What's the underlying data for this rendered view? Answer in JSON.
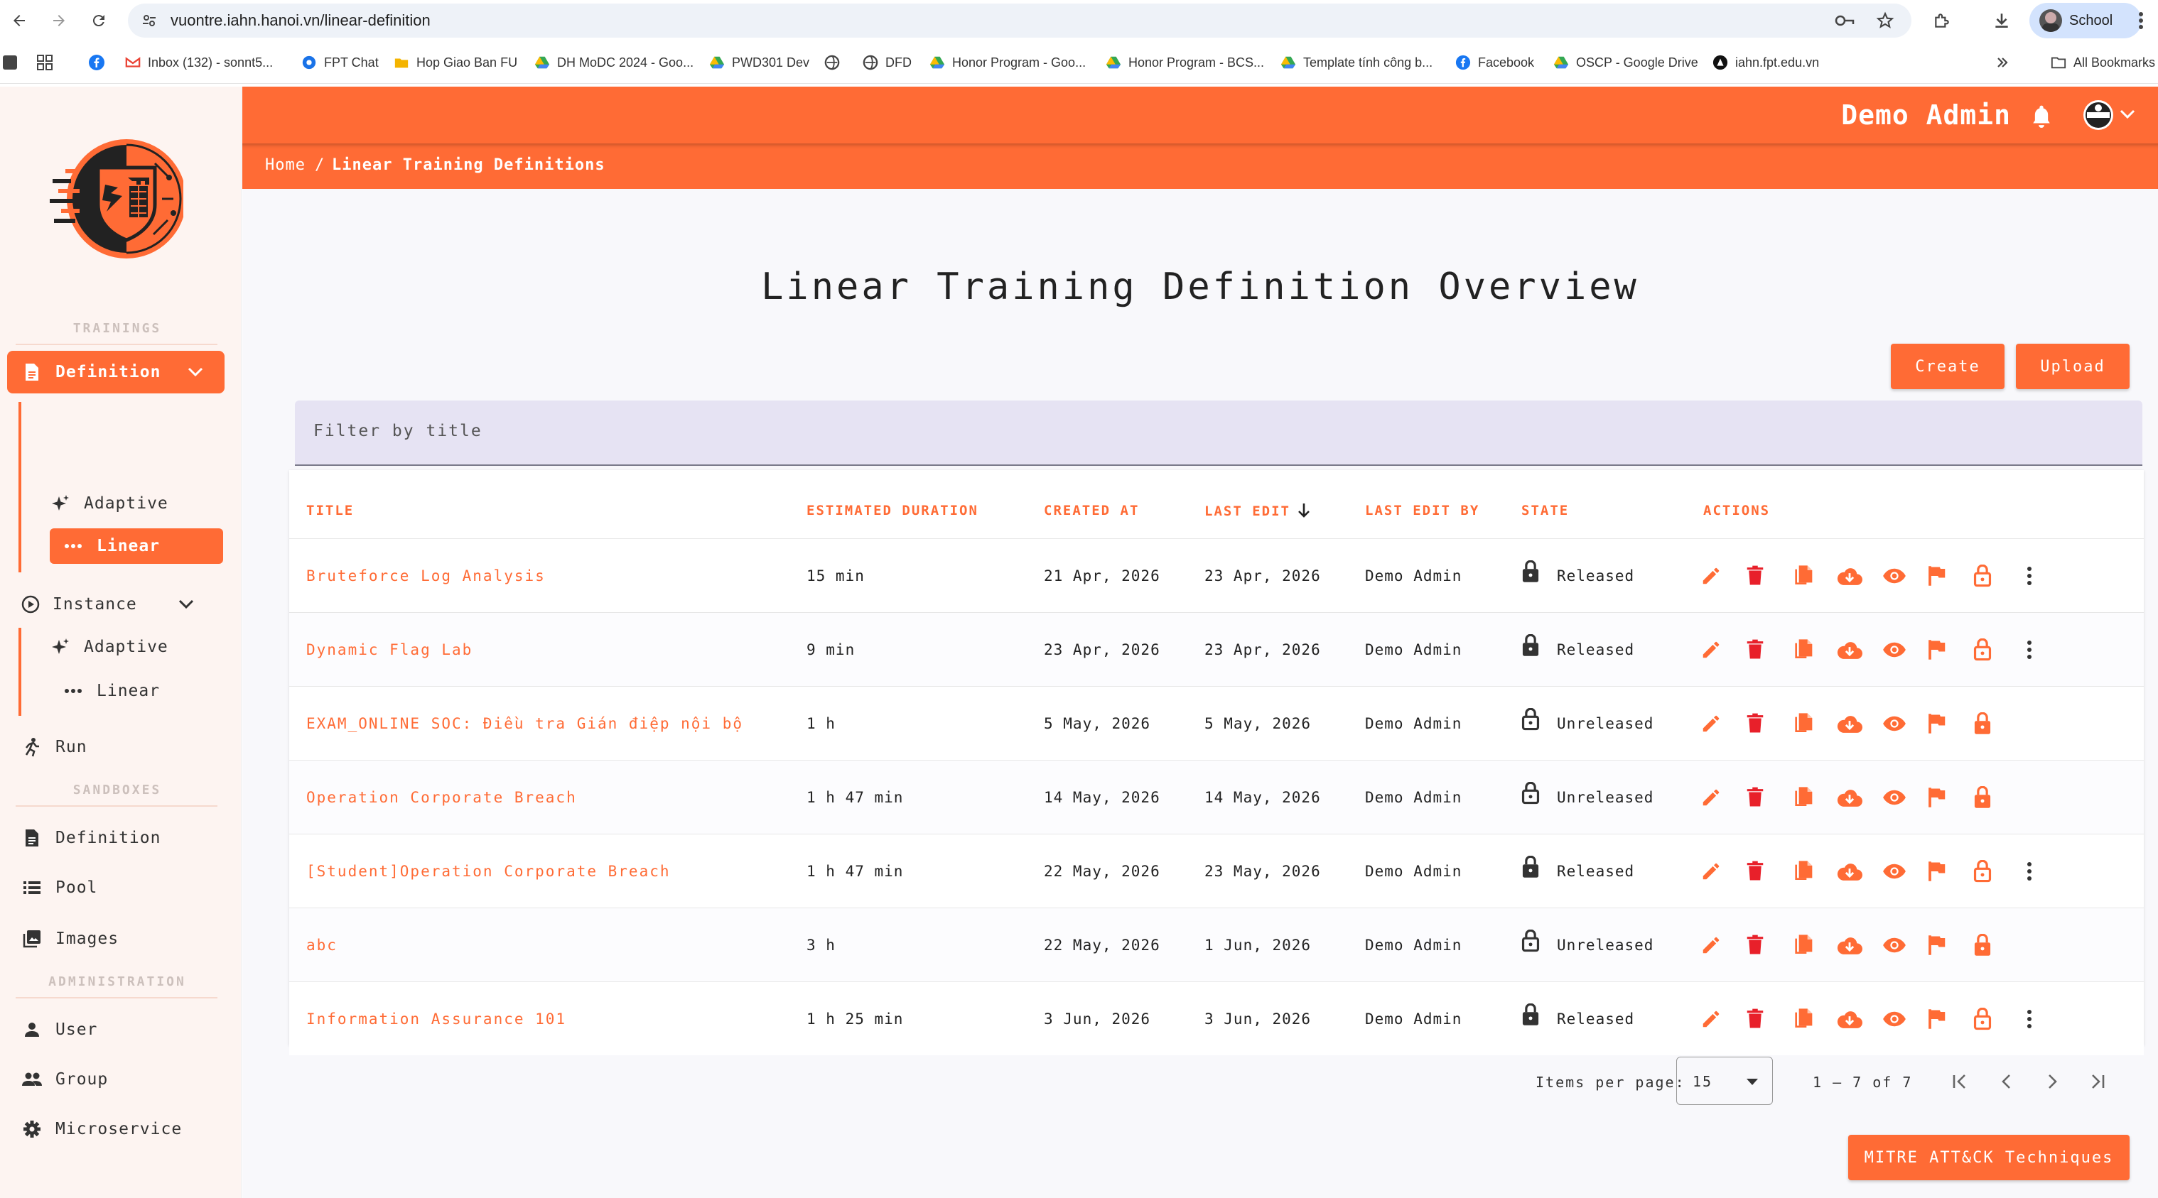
{
  "browser": {
    "url": "vuontre.iahn.hanoi.vn/linear-definition",
    "profile": "School",
    "bookmarks": [
      {
        "label": "Inbox (132) - sonnt5...",
        "icon": "gmail-icon"
      },
      {
        "label": "FPT Chat",
        "icon": "chat-icon"
      },
      {
        "label": "Hop Giao Ban FU",
        "icon": "folder-icon"
      },
      {
        "label": "DH MoDC 2024 - Goo...",
        "icon": "drive-icon"
      },
      {
        "label": "PWD301 Dev",
        "icon": "drive-icon"
      },
      {
        "label": "DFD",
        "icon": "globe-icon"
      },
      {
        "label": "Honor Program - Goo...",
        "icon": "drive-icon"
      },
      {
        "label": "Honor Program - BCS...",
        "icon": "drive-icon"
      },
      {
        "label": "Template tính công b...",
        "icon": "drive-icon"
      },
      {
        "label": "Facebook",
        "icon": "facebook-icon"
      },
      {
        "label": "OSCP - Google Drive",
        "icon": "drive-icon"
      },
      {
        "label": "iahn.fpt.edu.vn",
        "icon": "site-icon"
      }
    ],
    "all_bookmarks": "All Bookmarks"
  },
  "sidebar": {
    "sections": {
      "trainings": "TRAININGS",
      "sandboxes": "SANDBOXES",
      "administration": "ADMINISTRATION"
    },
    "definition": "Definition",
    "definition_adaptive": "Adaptive",
    "definition_linear": "Linear",
    "instance": "Instance",
    "instance_adaptive": "Adaptive",
    "instance_linear": "Linear",
    "run": "Run",
    "sandbox_definition": "Definition",
    "pool": "Pool",
    "images": "Images",
    "user": "User",
    "group": "Group",
    "microservice": "Microservice"
  },
  "header": {
    "user_name": "Demo Admin",
    "breadcrumb_home": "Home",
    "breadcrumb_sep": "/",
    "breadcrumb_current": "Linear Training Definitions"
  },
  "main": {
    "title": "Linear Training Definition Overview",
    "create_label": "Create",
    "upload_label": "Upload",
    "filter_placeholder": "Filter by title",
    "columns": {
      "title": "TITLE",
      "duration": "ESTIMATED DURATION",
      "created": "CREATED AT",
      "last_edit": "LAST EDIT",
      "last_edit_by": "LAST EDIT BY",
      "state": "STATE",
      "actions": "ACTIONS"
    },
    "rows": [
      {
        "title": "Bruteforce Log Analysis",
        "duration": "15 min",
        "created": "21 Apr, 2026",
        "last_edit": "23 Apr, 2026",
        "by": "Demo Admin",
        "state": "Released"
      },
      {
        "title": "Dynamic Flag Lab",
        "duration": "9 min",
        "created": "23 Apr, 2026",
        "last_edit": "23 Apr, 2026",
        "by": "Demo Admin",
        "state": "Released"
      },
      {
        "title": "EXAM_ONLINE SOC: Điều tra Gián điệp nội bộ",
        "duration": "1 h",
        "created": "5 May, 2026",
        "last_edit": "5 May, 2026",
        "by": "Demo Admin",
        "state": "Unreleased"
      },
      {
        "title": "Operation Corporate Breach",
        "duration": "1 h 47 min",
        "created": "14 May, 2026",
        "last_edit": "14 May, 2026",
        "by": "Demo Admin",
        "state": "Unreleased"
      },
      {
        "title": "[Student]Operation Corporate Breach",
        "duration": "1 h 47 min",
        "created": "22 May, 2026",
        "last_edit": "23 May, 2026",
        "by": "Demo Admin",
        "state": "Released"
      },
      {
        "title": "abc",
        "duration": "3 h",
        "created": "22 May, 2026",
        "last_edit": "1 Jun, 2026",
        "by": "Demo Admin",
        "state": "Unreleased"
      },
      {
        "title": "Information Assurance 101",
        "duration": "1 h 25 min",
        "created": "3 Jun, 2026",
        "last_edit": "3 Jun, 2026",
        "by": "Demo Admin",
        "state": "Released"
      }
    ],
    "paginator": {
      "items_per_page_label": "Items per page:",
      "items_per_page": "15",
      "range": "1 – 7 of 7"
    },
    "mitre_label": "MITRE ATT&CK Techniques"
  },
  "colors": {
    "accent": "#ff6b35",
    "delete": "#e8202a"
  }
}
